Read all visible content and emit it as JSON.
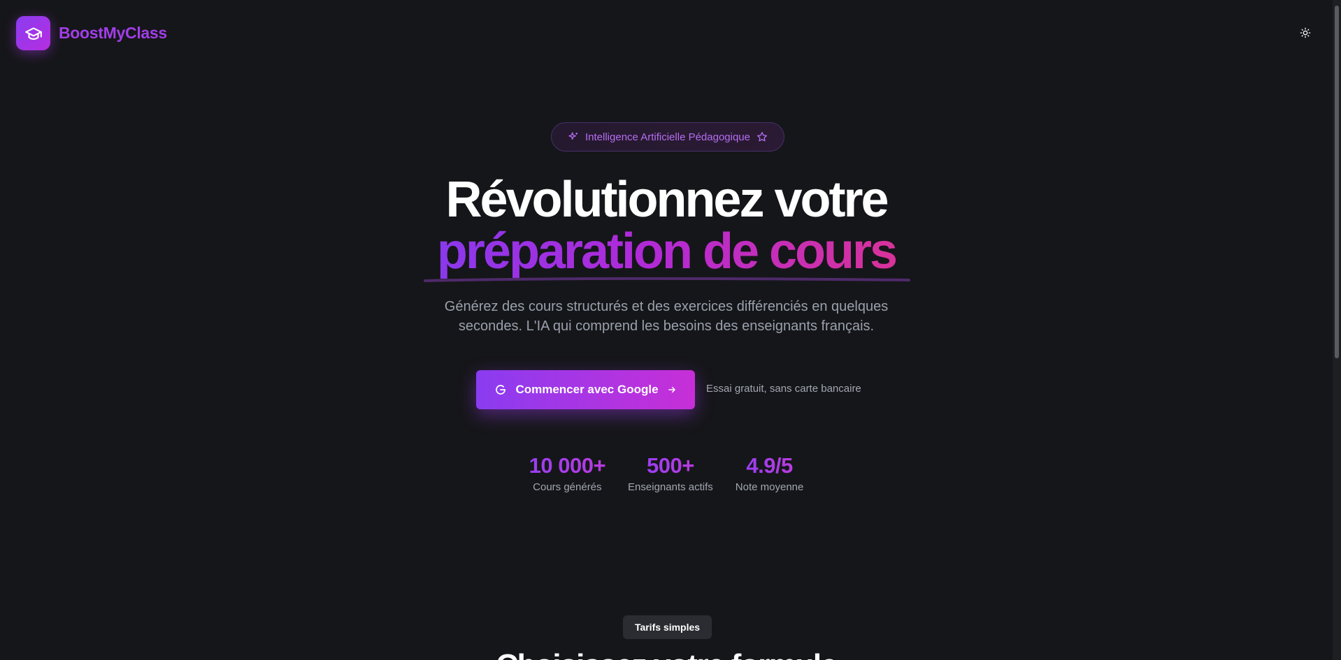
{
  "header": {
    "brand": "BoostMyClass",
    "icons": {
      "logo": "graduation-cap-icon",
      "theme_toggle": "sun-icon"
    }
  },
  "hero": {
    "badge": {
      "label": "Intelligence Artificielle Pédagogique",
      "icons": [
        "sparkles-icon",
        "star-icon"
      ]
    },
    "headline_line1": "Révolutionnez votre",
    "headline_line2": "préparation de cours",
    "subtitle": "Générez des cours structurés et des exercices différenciés en quelques secondes. L'IA qui comprend les besoins des enseignants français.",
    "cta": {
      "label": "Commencer avec Google",
      "icons": [
        "google-g-icon",
        "arrow-right-icon"
      ]
    },
    "cta_note": "Essai gratuit, sans carte bancaire"
  },
  "stats": [
    {
      "value": "10 000+",
      "label": "Cours générés"
    },
    {
      "value": "500+",
      "label": "Enseignants actifs"
    },
    {
      "value": "4.9/5",
      "label": "Note moyenne"
    }
  ],
  "pricing": {
    "pill": "Tarifs simples",
    "title": "Choisissez votre formule"
  },
  "colors": {
    "background": "#151619",
    "brand_purple": "#a13ee8",
    "gradient_start": "#8a38ec",
    "gradient_end": "#d8329a",
    "muted_text": "#9aa0ad"
  }
}
